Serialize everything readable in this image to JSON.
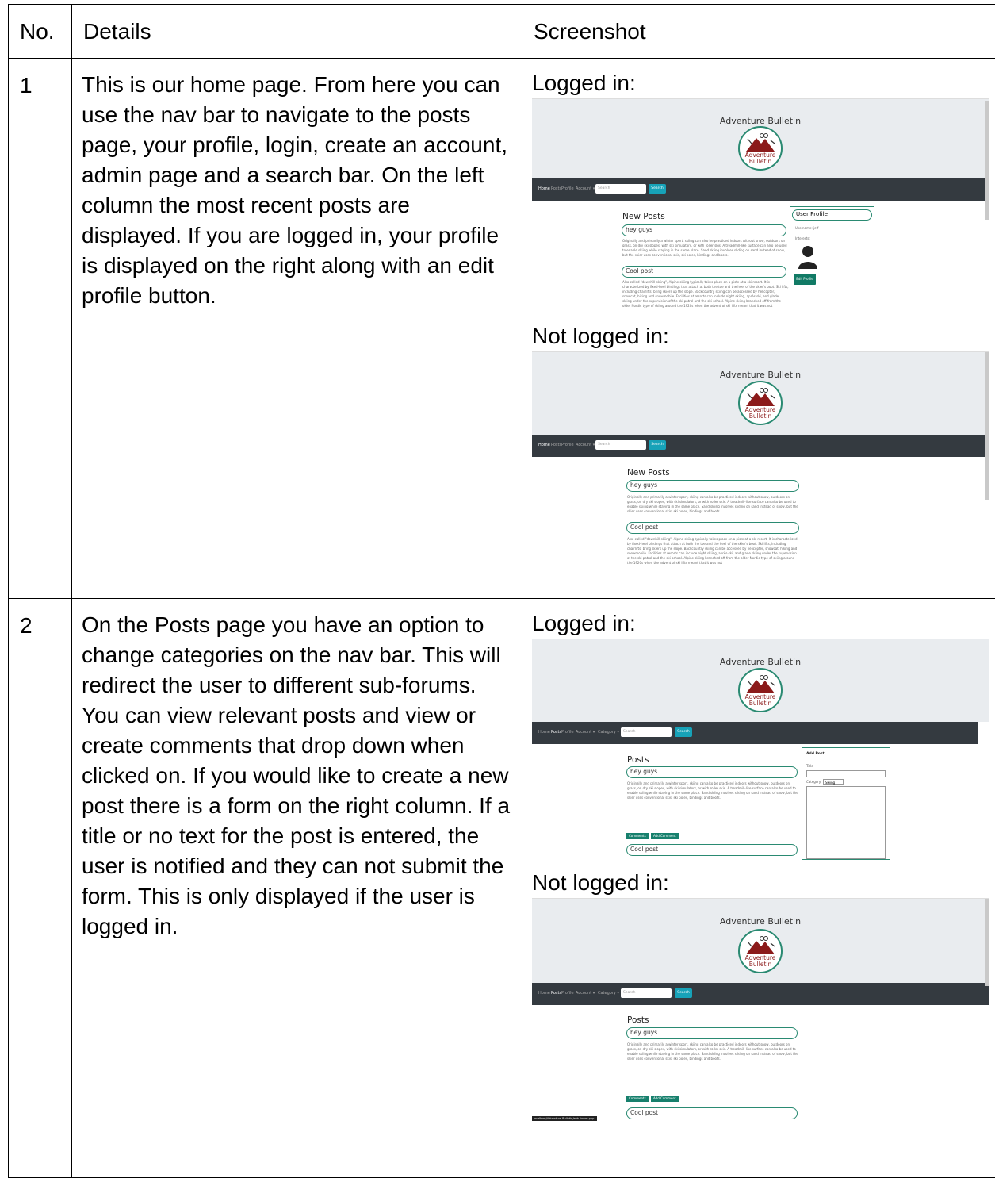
{
  "table": {
    "headers": [
      "No.",
      "Details",
      "Screenshot"
    ],
    "rows": [
      {
        "number": "1",
        "details": "This is our home page. From here you can use the nav bar to navigate to the posts page, your profile, login, create an account, admin page and a search bar. On the left column the most recent posts are displayed. If you are logged in, your profile is displayed on the right along with an edit profile button.",
        "shot_labels": [
          "Logged in:",
          "Not logged in:"
        ]
      },
      {
        "number": "2",
        "details": "On the Posts page you have an option to change categories on the nav bar. This will redirect the user to different sub-forums. You can view relevant posts and view or create comments that drop down when clicked on. If you would like to create a new post there is a form on the right column. If a title or no text for the post is entered, the user is notified and they can not submit the form. This is only displayed if the user is logged in.",
        "shot_labels": [
          "Logged in:",
          "Not logged in:"
        ]
      }
    ]
  },
  "site": {
    "title": "Adventure Bulletin",
    "logo_text": [
      "Adventure",
      "Bulletin"
    ]
  },
  "nav": {
    "home": "Home",
    "posts": "Posts",
    "profile": "Profile",
    "account": "Account ▾",
    "category": "Category ▾",
    "search_placeholder": "Search",
    "search_button": "Search"
  },
  "home": {
    "column_title": "New Posts",
    "post1_title": "hey guys",
    "post1_body": "Originally and primarily a winter sport, skiing can also be practiced indoors without snow, outdoors on grass, on dry ski slopes, with ski simulators, or with roller skis. A treadmill-like surface can also be used to enable skiing while staying in the same place. Sand skiing involves sliding on sand instead of snow, but the skier uses conventional skis, ski poles, bindings and boots.",
    "post2_title": "Cool post",
    "post2_body": "Also called \"downhill skiing\", Alpine skiing typically takes place on a piste at a ski resort. It is characterized by fixed-heel bindings that attach at both the toe and the heel of the skier's boot. Ski lifts, including chairlifts, bring skiers up the slope. Backcountry skiing can be accessed by helicopter, snowcat, hiking and snowmobile. Facilities at resorts can include night skiing, après-ski, and glade skiing under the supervision of the ski patrol and the ski school. Alpine skiing branched off from the older Nordic type of skiing around the 1920s when the advent of ski lifts meant that it was not",
    "profile_title": "User Profile",
    "profile_username": "Username: jeff",
    "profile_interests": "Interests:",
    "edit_profile": "Edit Profile"
  },
  "posts_page": {
    "column_title": "Posts",
    "comments_button": "Comments",
    "add_comment_button": "Add Comment",
    "form_title": "Add Post",
    "form_title_label": "Title",
    "form_category_label": "Category",
    "form_category_value": "Skiing",
    "status_url": "localhost/Adventure Bulletin/sub-forum.php"
  }
}
